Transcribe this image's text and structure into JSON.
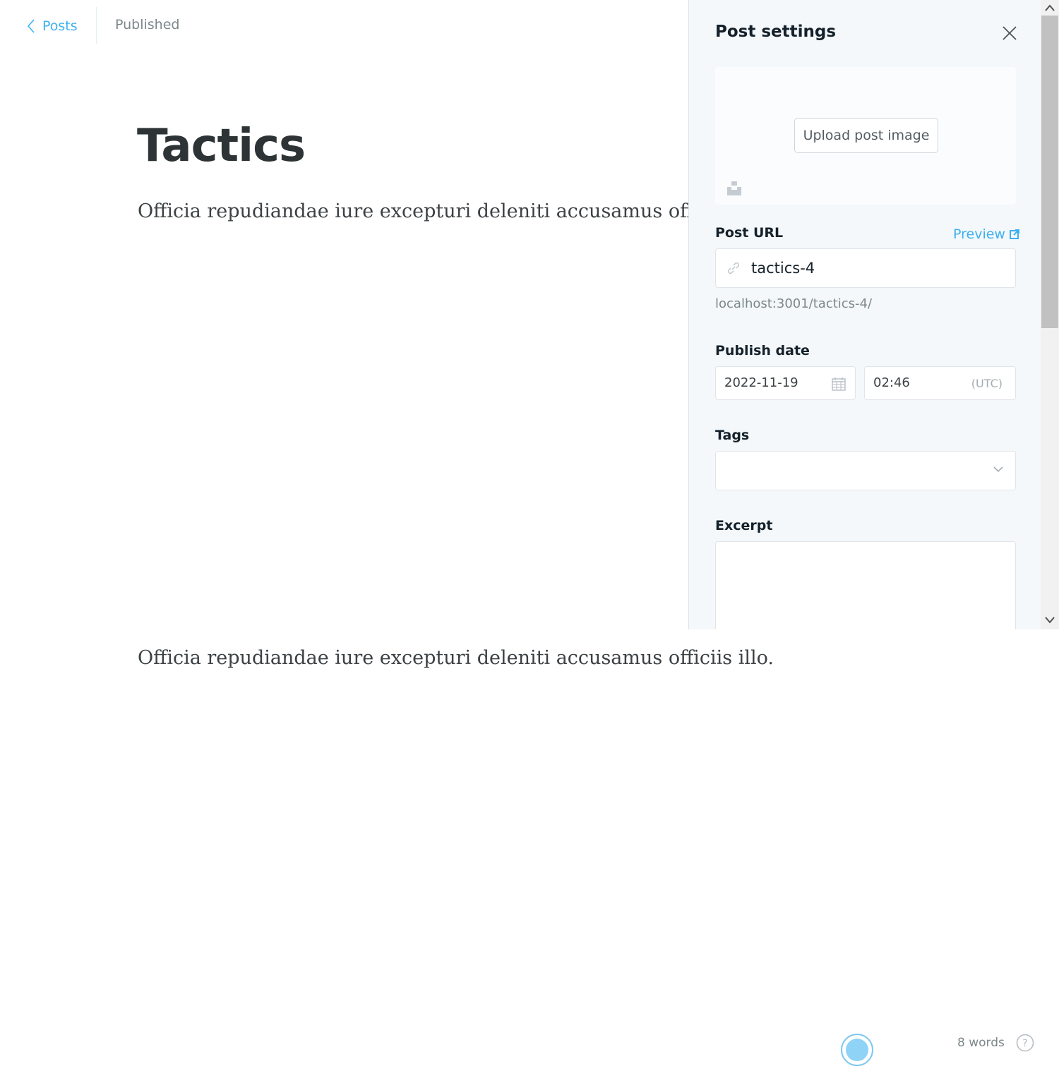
{
  "topbar": {
    "back_label": "Posts",
    "status": "Published"
  },
  "editor": {
    "title": "Tactics",
    "paragraphs": [
      "Officia repudiandae iure excepturi deleniti accusamus offic",
      "Officia repudiandae iure excepturi deleniti accusamus officiis illo."
    ]
  },
  "settings": {
    "title": "Post settings",
    "upload_label": "Upload post image",
    "url_label": "Post URL",
    "preview_label": "Preview",
    "url_value": "tactics-4",
    "url_hint": "localhost:3001/tactics-4/",
    "publish_label": "Publish date",
    "date_value": "2022-11-19",
    "time_value": "02:46",
    "timezone": "(UTC)",
    "tags_label": "Tags",
    "excerpt_label": "Excerpt"
  },
  "footer": {
    "word_count": "8 words"
  },
  "colors": {
    "accent": "#3eb0ef",
    "panel_bg": "#f4f8fb",
    "title_text": "#2e3436"
  }
}
